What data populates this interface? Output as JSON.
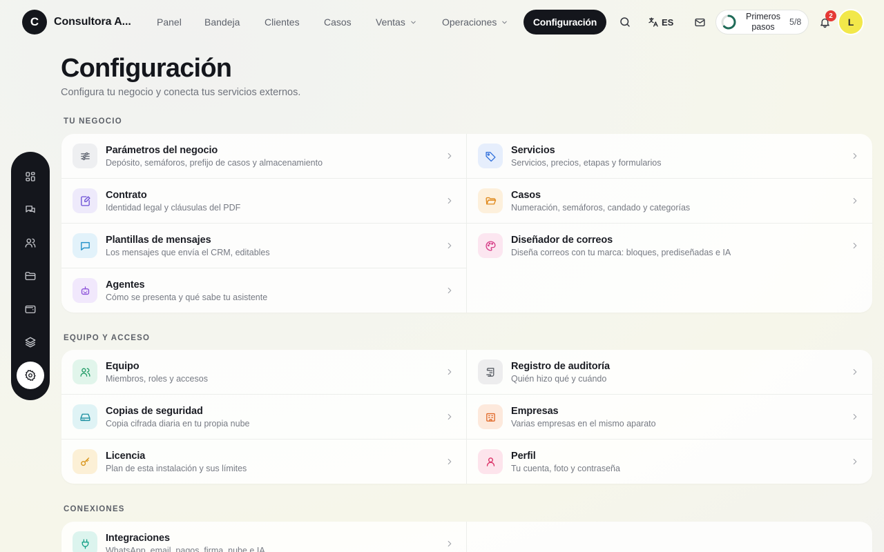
{
  "brand": {
    "initial": "C",
    "name": "Consultora A..."
  },
  "nav": {
    "items": [
      {
        "label": "Panel"
      },
      {
        "label": "Bandeja"
      },
      {
        "label": "Clientes"
      },
      {
        "label": "Casos"
      },
      {
        "label": "Ventas"
      },
      {
        "label": "Operaciones"
      }
    ],
    "active_label": "Configuración"
  },
  "topbar": {
    "language": "ES",
    "onboarding": {
      "label": "Primeros pasos",
      "count": "5/8",
      "progress": 0.625
    },
    "notifications_count": "2",
    "avatar_initial": "L"
  },
  "icons": {
    "search": "search-icon",
    "translate": "translate-icon",
    "mail": "mail-icon",
    "bell": "bell-icon"
  },
  "rail": {
    "items": [
      {
        "icon": "dashboard-grid-icon"
      },
      {
        "icon": "chat-bubbles-icon"
      },
      {
        "icon": "users-icon"
      },
      {
        "icon": "folder-icon"
      },
      {
        "icon": "wallet-icon"
      },
      {
        "icon": "layers-icon"
      },
      {
        "icon": "gear-icon",
        "active": true
      }
    ]
  },
  "page": {
    "title": "Configuración",
    "subtitle": "Configura tu negocio y conecta tus servicios externos."
  },
  "sections": {
    "negocio": {
      "title": "TU NEGOCIO",
      "items": [
        {
          "title": "Parámetros del negocio",
          "desc": "Depósito, semáforos, prefijo de casos y almacenamiento",
          "icon": "sliders-icon",
          "color": "#5f6470",
          "bg": "#eeeff1"
        },
        {
          "title": "Servicios",
          "desc": "Servicios, precios, etapas y formularios",
          "icon": "tag-icon",
          "color": "#2f6fdb",
          "bg": "#e6eefc"
        },
        {
          "title": "Contrato",
          "desc": "Identidad legal y cláusulas del PDF",
          "icon": "document-edit-icon",
          "color": "#6c4fd6",
          "bg": "#eeeafb"
        },
        {
          "title": "Casos",
          "desc": "Numeración, semáforos, candado y categorías",
          "icon": "folder-open-icon",
          "color": "#e08a1e",
          "bg": "#fdf0dc"
        },
        {
          "title": "Plantillas de mensajes",
          "desc": "Los mensajes que envía el CRM, editables",
          "icon": "message-icon",
          "color": "#1e8fc7",
          "bg": "#e2f2fa"
        },
        {
          "title": "Diseñador de correos",
          "desc": "Diseña correos con tu marca: bloques, prediseñadas e IA",
          "icon": "palette-icon",
          "color": "#d63b86",
          "bg": "#fce6f0"
        },
        {
          "title": "Agentes",
          "desc": "Cómo se presenta y qué sabe tu asistente",
          "icon": "bot-icon",
          "color": "#8a4fd8",
          "bg": "#f1e8fc"
        }
      ]
    },
    "equipo": {
      "title": "EQUIPO Y ACCESO",
      "items": [
        {
          "title": "Equipo",
          "desc": "Miembros, roles y accesos",
          "icon": "team-icon",
          "color": "#1e9a64",
          "bg": "#e1f5eb"
        },
        {
          "title": "Registro de auditoría",
          "desc": "Quién hizo qué y cuándo",
          "icon": "audit-scroll-icon",
          "color": "#5a5e66",
          "bg": "#ededee"
        },
        {
          "title": "Copias de seguridad",
          "desc": "Copia cifrada diaria en tu propia nube",
          "icon": "hard-drive-icon",
          "color": "#1a8fa0",
          "bg": "#dff3f5"
        },
        {
          "title": "Empresas",
          "desc": "Varias empresas en el mismo aparato",
          "icon": "building-icon",
          "color": "#e06a2a",
          "bg": "#fde9dc"
        },
        {
          "title": "Licencia",
          "desc": "Plan de esta instalación y sus límites",
          "icon": "key-icon",
          "color": "#d8951a",
          "bg": "#fcf0d6"
        },
        {
          "title": "Perfil",
          "desc": "Tu cuenta, foto y contraseña",
          "icon": "user-icon",
          "color": "#db3368",
          "bg": "#fde4ec"
        }
      ]
    },
    "conexiones": {
      "title": "CONEXIONES",
      "items": [
        {
          "title": "Integraciones",
          "desc": "WhatsApp, email, pagos, firma, nube e IA",
          "icon": "plug-icon",
          "color": "#14a087",
          "bg": "#dcf4ee"
        }
      ]
    }
  }
}
